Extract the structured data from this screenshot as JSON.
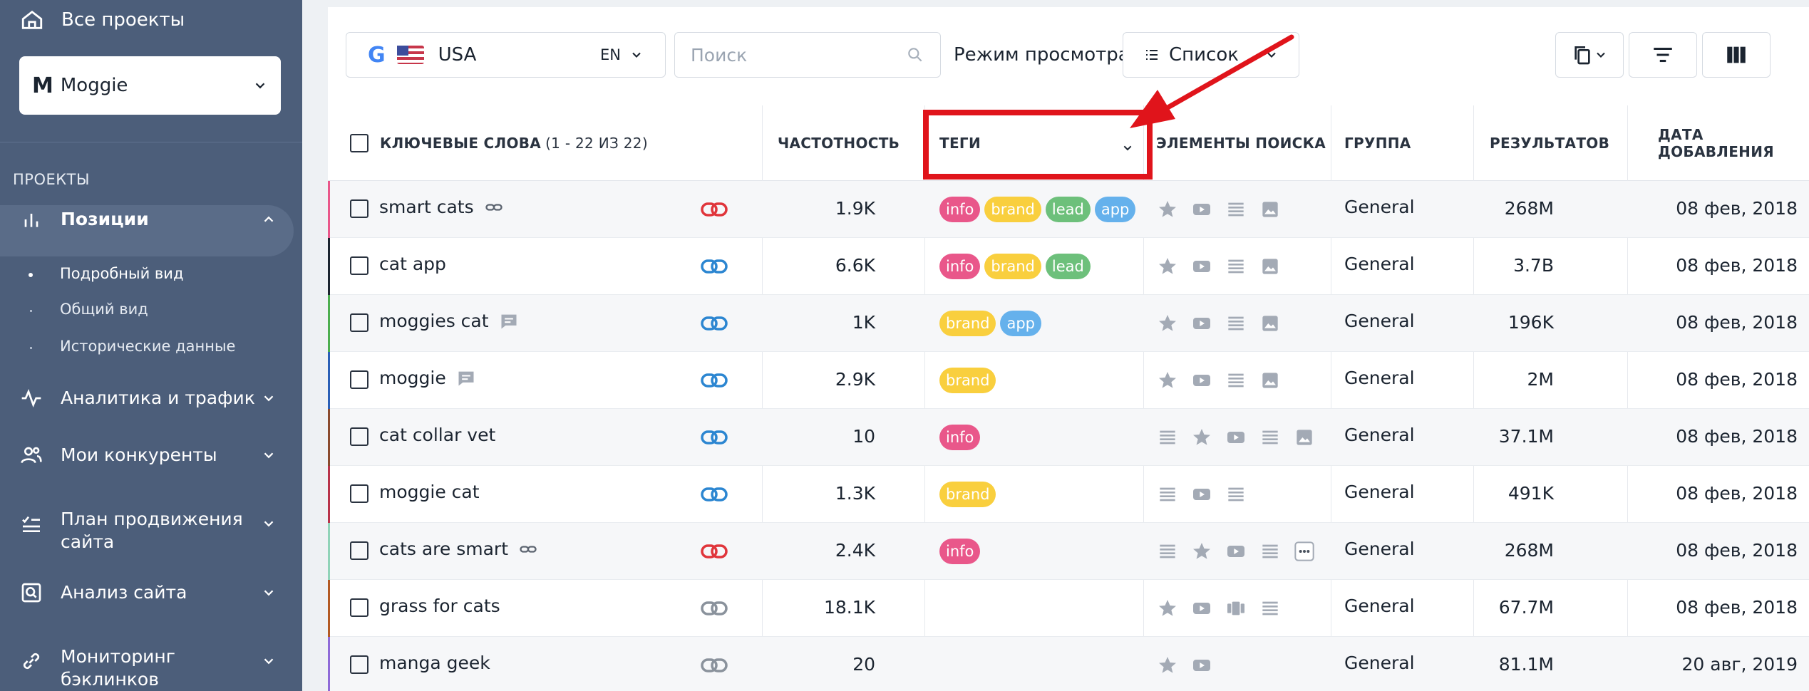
{
  "sidebar": {
    "all_projects": "Все проекты",
    "project": "Moggie",
    "section_label": "ПРОЕКТЫ",
    "nav": [
      {
        "label": "Позиции",
        "icon": "bar-chart-icon"
      },
      {
        "label": "Аналитика и трафик",
        "icon": "pulse-icon"
      },
      {
        "label": "Мои конкуренты",
        "icon": "users-icon"
      },
      {
        "label": "План продвижения",
        "label2": "сайта",
        "icon": "checklist-icon"
      },
      {
        "label": "Анализ сайта",
        "icon": "site-audit-icon"
      },
      {
        "label": "Мониторинг",
        "label2": "бэклинков",
        "icon": "link-icon"
      }
    ],
    "sub_items": [
      "Подробный вид",
      "Общий вид",
      "Исторические данные"
    ]
  },
  "toolbar": {
    "country": "USA",
    "language": "EN",
    "search_placeholder": "Поиск",
    "view_label": "Режим просмотра:",
    "view_value": "Список"
  },
  "table": {
    "headers": {
      "keywords": "КЛЮЧЕВЫЕ СЛОВА",
      "keywords_count": "(1 - 22 ИЗ 22)",
      "frequency": "ЧАСТОТНОСТЬ",
      "tags": "ТЕГИ",
      "search_elements": "ЭЛЕМЕНТЫ ПОИСКА",
      "group": "ГРУППА",
      "results": "РЕЗУЛЬТАТОВ",
      "date_added": "ДАТА ДОБАВЛЕНИЯ"
    },
    "rows": [
      {
        "keyword": "smart cats",
        "extra": "link",
        "link_color": "#e0353b",
        "accent": "#e9578a",
        "frequency": "1.9K",
        "tags": [
          "info",
          "brand",
          "lead",
          "app"
        ],
        "elements": [
          "star",
          "video",
          "list",
          "image"
        ],
        "group": "General",
        "results": "268M",
        "date": "08 фев, 2018"
      },
      {
        "keyword": "cat app",
        "extra": "",
        "link_color": "#2c86d1",
        "accent": "#1b2430",
        "frequency": "6.6K",
        "tags": [
          "info",
          "brand",
          "lead"
        ],
        "elements": [
          "star",
          "video",
          "list",
          "image"
        ],
        "group": "General",
        "results": "3.7B",
        "date": "08 фев, 2018"
      },
      {
        "keyword": "moggies cat",
        "extra": "comment",
        "link_color": "#2c86d1",
        "accent": "#4cae4f",
        "frequency": "1K",
        "tags": [
          "brand",
          "app"
        ],
        "elements": [
          "star",
          "video",
          "list",
          "image"
        ],
        "group": "General",
        "results": "196K",
        "date": "08 фев, 2018"
      },
      {
        "keyword": "moggie",
        "extra": "comment",
        "link_color": "#2c86d1",
        "accent": "#2a5fb6",
        "frequency": "2.9K",
        "tags": [
          "brand"
        ],
        "elements": [
          "star",
          "video",
          "list",
          "image"
        ],
        "group": "General",
        "results": "2M",
        "date": "08 фев, 2018"
      },
      {
        "keyword": "cat collar vet",
        "extra": "",
        "link_color": "#2c86d1",
        "accent": "#8a4a2e",
        "frequency": "10",
        "tags": [
          "info"
        ],
        "elements": [
          "list",
          "star",
          "video",
          "list",
          "image"
        ],
        "group": "General",
        "results": "37.1M",
        "date": "08 фев, 2018"
      },
      {
        "keyword": "moggie cat",
        "extra": "",
        "link_color": "#2c86d1",
        "accent": "#b8334a",
        "frequency": "1.3K",
        "tags": [
          "brand"
        ],
        "elements": [
          "list",
          "video",
          "list"
        ],
        "group": "General",
        "results": "491K",
        "date": "08 фев, 2018"
      },
      {
        "keyword": "cats are smart",
        "extra": "link",
        "link_color": "#e0353b",
        "accent": "#8fd3b8",
        "frequency": "2.4K",
        "tags": [
          "info"
        ],
        "elements": [
          "list",
          "star",
          "video",
          "list",
          "more"
        ],
        "group": "General",
        "results": "268M",
        "date": "08 фев, 2018"
      },
      {
        "keyword": "grass for cats",
        "extra": "",
        "link_color": "#8a929c",
        "accent": "#b35a24",
        "frequency": "18.1K",
        "tags": [],
        "elements": [
          "star",
          "video",
          "carousel",
          "list"
        ],
        "group": "General",
        "results": "67.7M",
        "date": "08 фев, 2018"
      },
      {
        "keyword": "manga geek",
        "extra": "",
        "link_color": "#8a929c",
        "accent": "#8e6ad8",
        "frequency": "20",
        "tags": [],
        "elements": [
          "star",
          "video"
        ],
        "group": "General",
        "results": "81.1M",
        "date": "20 авг, 2019"
      }
    ]
  },
  "annotation": {
    "color": "#e0141b"
  }
}
